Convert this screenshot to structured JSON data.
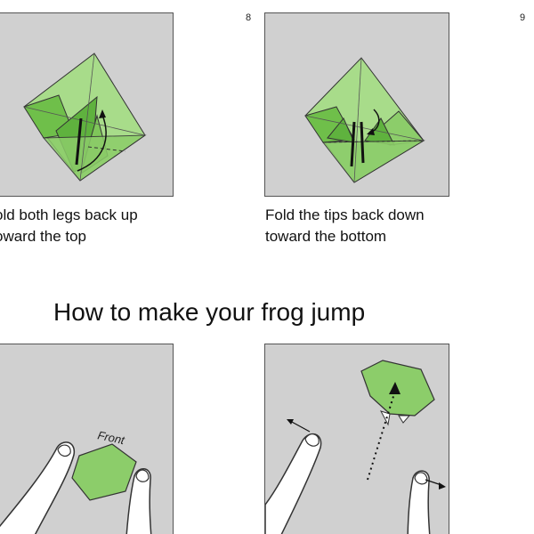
{
  "steps": [
    {
      "number": "8",
      "caption_lines": [
        "old both legs back up",
        "oward the top"
      ]
    },
    {
      "number": "9",
      "caption_lines": [
        "Fold the tips back down",
        "toward the bottom"
      ]
    }
  ],
  "section": {
    "heading": "How to make your frog jump",
    "front_label": "Front"
  },
  "colors": {
    "panel_background": "#d0d0d0",
    "paper_light": "#a8dc8a",
    "paper_mid": "#8ccd6a",
    "paper_dark": "#5fb23e",
    "outline": "#333333"
  }
}
